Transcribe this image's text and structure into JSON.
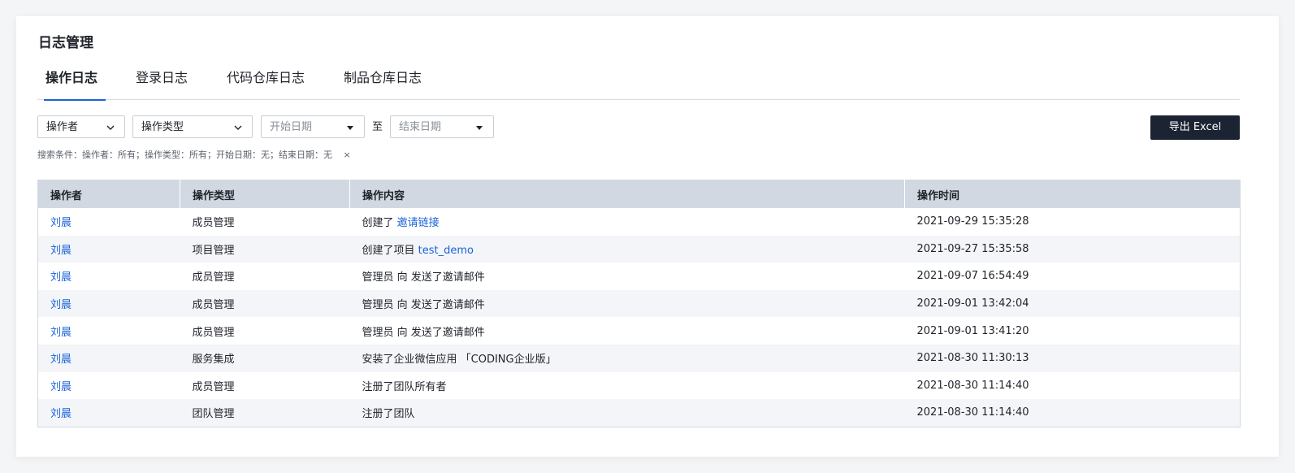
{
  "page_title": "日志管理",
  "tabs": [
    {
      "label": "操作日志",
      "active": true
    },
    {
      "label": "登录日志",
      "active": false
    },
    {
      "label": "代码仓库日志",
      "active": false
    },
    {
      "label": "制品仓库日志",
      "active": false
    }
  ],
  "filters": {
    "operator": "操作者",
    "op_type": "操作类型",
    "start_date_placeholder": "开始日期",
    "to": "至",
    "end_date_placeholder": "结束日期",
    "export_label": "导出 Excel"
  },
  "search_conditions": "搜索条件：操作者：所有；操作类型：所有；开始日期：无；结束日期：无",
  "clear_icon": "×",
  "table": {
    "headers": [
      "操作者",
      "操作类型",
      "操作内容",
      "操作时间"
    ],
    "rows": [
      {
        "operator": "刘晨",
        "type": "成员管理",
        "content": "创建了 ",
        "content_link": "邀请链接",
        "time": "2021-09-29 15:35:28"
      },
      {
        "operator": "刘晨",
        "type": "项目管理",
        "content": "创建了项目 ",
        "content_link": "test_demo",
        "time": "2021-09-27 15:35:58"
      },
      {
        "operator": "刘晨",
        "type": "成员管理",
        "content": "管理员 向 发送了邀请邮件",
        "content_link": "",
        "time": "2021-09-07 16:54:49"
      },
      {
        "operator": "刘晨",
        "type": "成员管理",
        "content": "管理员 向 发送了邀请邮件",
        "content_link": "",
        "time": "2021-09-01 13:42:04"
      },
      {
        "operator": "刘晨",
        "type": "成员管理",
        "content": "管理员 向 发送了邀请邮件",
        "content_link": "",
        "time": "2021-09-01 13:41:20"
      },
      {
        "operator": "刘晨",
        "type": "服务集成",
        "content": "安装了企业微信应用 「CODING企业版」",
        "content_link": "",
        "time": "2021-08-30 11:30:13"
      },
      {
        "operator": "刘晨",
        "type": "成员管理",
        "content": "注册了团队所有者",
        "content_link": "",
        "time": "2021-08-30 11:14:40"
      },
      {
        "operator": "刘晨",
        "type": "团队管理",
        "content": "注册了团队",
        "content_link": "",
        "time": "2021-08-30 11:14:40"
      }
    ]
  },
  "colors": {
    "accent": "#1a63d8",
    "export_bg": "#1c2434",
    "header_bg": "#d2d8e1",
    "stripe_bg": "#f3f5f8"
  }
}
